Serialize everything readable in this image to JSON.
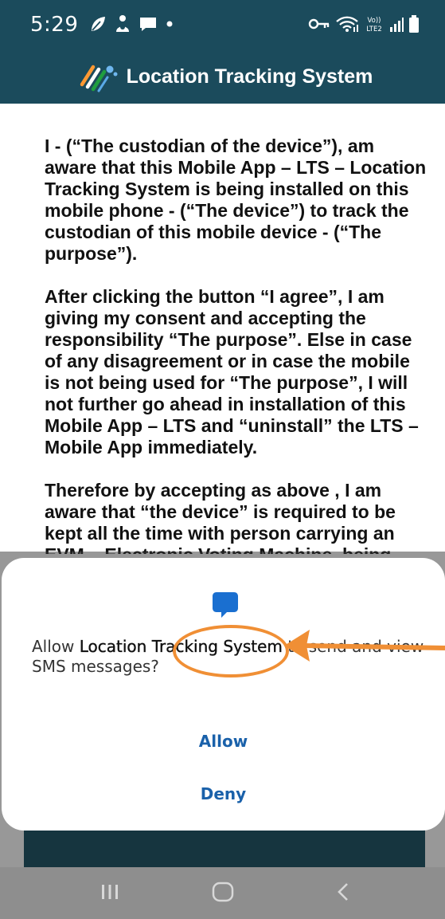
{
  "status_bar": {
    "time": "5:29",
    "left_icons": [
      "leaf-icon",
      "fingerprint-icon",
      "chat-icon",
      "dot-icon"
    ],
    "right_icons": [
      "key-icon",
      "wifi-icon",
      "volte-icon",
      "signal-icon",
      "battery-icon"
    ],
    "volte_label": "Vo))",
    "lte_label": "LTE2"
  },
  "app_bar": {
    "title": "Location Tracking System",
    "logo": "eci-logo-icon"
  },
  "content": {
    "paragraphs": [
      "I - (“The custodian of the device”),  am aware that this Mobile App – LTS – Location Tracking System is being installed on this mobile phone - (“The device”) to track the custodian of this mobile device - (“The purpose”).",
      " After clicking the button   “I agree”, I am giving my consent and accepting the responsibility “The purpose”. Else in case of any disagreement or in case the mobile is not being used for “The purpose”, I will not further go ahead in installation of this Mobile App – LTS  and “uninstall” the LTS – Mobile App immediately.",
      " Therefore by accepting as above , I am aware that “the device”  is required to be kept all the time with person carrying an EVM – Electronic Voting Machine,  being used for conducting"
    ]
  },
  "dialog": {
    "icon": "sms-icon",
    "message_prefix": "Allow ",
    "app_name": "Location Tracking System",
    "message_suffix": " to send and view SMS messages?",
    "allow_label": "Allow",
    "deny_label": "Deny"
  },
  "nav_bar": {
    "buttons": [
      "recent-apps-icon",
      "home-icon",
      "back-icon"
    ]
  },
  "colors": {
    "app_bar": "#1b4b5c",
    "button_text": "#1a61aa",
    "annotation": "#f08f35",
    "nav_bar": "#8e8e8e"
  }
}
